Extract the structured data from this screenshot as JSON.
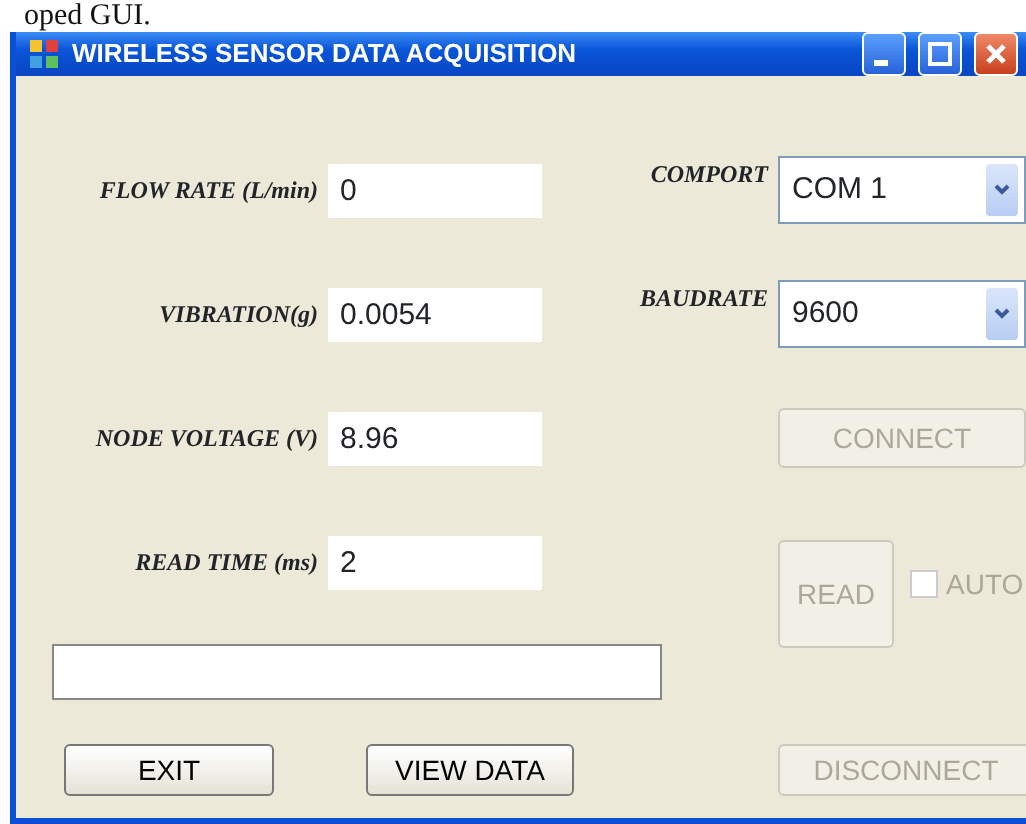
{
  "caption": "oped GUI.",
  "window": {
    "title": "WIRELESS SENSOR DATA ACQUISITION"
  },
  "readings": [
    {
      "label": "FLOW RATE (L/min)",
      "value": "0"
    },
    {
      "label": "VIBRATION(g)",
      "value": "0.0054"
    },
    {
      "label": "NODE VOLTAGE (V)",
      "value": "8.96"
    },
    {
      "label": "READ TIME (ms)",
      "value": "2"
    }
  ],
  "port_settings": [
    {
      "label": "COMPORT",
      "value": "COM 1"
    },
    {
      "label": "BAUDRATE",
      "value": "9600"
    }
  ],
  "connect_button": {
    "label": "CONNECT",
    "disabled": true
  },
  "read_button": {
    "label": "READ",
    "disabled": true
  },
  "auto_checkbox": {
    "label": "AUTO",
    "checked": false,
    "disabled": true
  },
  "bottom_buttons": [
    {
      "label": "EXIT",
      "disabled": false
    },
    {
      "label": "VIEW DATA",
      "disabled": false
    },
    {
      "label": "DISCONNECT",
      "disabled": true
    }
  ]
}
